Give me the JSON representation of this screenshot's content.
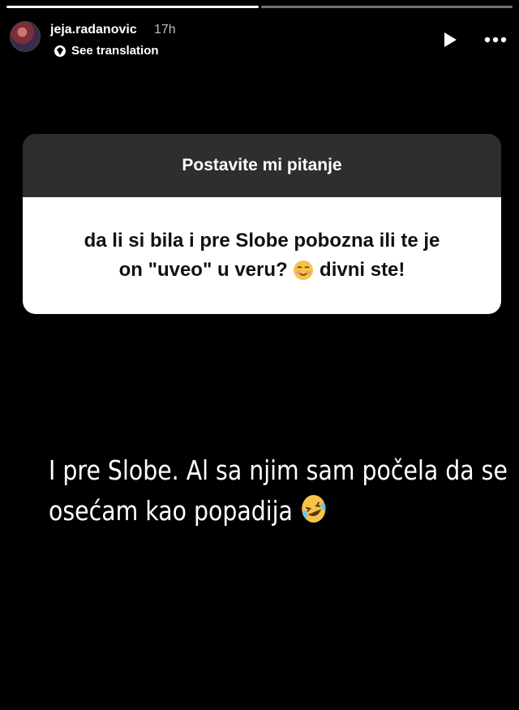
{
  "story": {
    "username": "jeja.radanovic",
    "time": "17h",
    "translation_label": "See translation",
    "segments_total": 2,
    "segments_done": 1
  },
  "question_sticker": {
    "header": "Postavite mi pitanje",
    "question_line1": "da li si bila i pre Slobe pobozna ili te je",
    "question_line2": "on \"uveo\" u veru?",
    "question_emoji": "smiling-face-icon",
    "question_tail": " divni ste!"
  },
  "answer": {
    "line1": "I pre Slobe. Al sa njim sam počela da se",
    "line2": "osećam kao popadija ",
    "emoji": "rolling-laughing-icon"
  }
}
